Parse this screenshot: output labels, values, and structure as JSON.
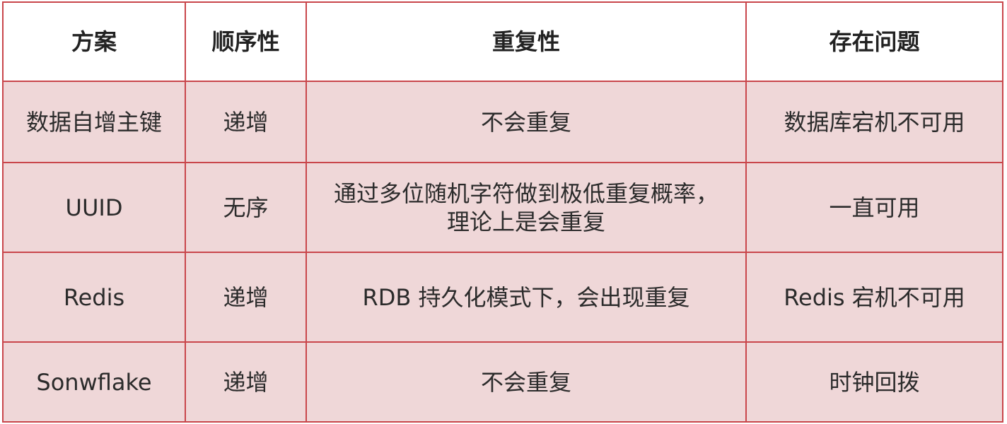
{
  "headers": [
    "方案",
    "顺序性",
    "重复性",
    "存在问题"
  ],
  "rows": [
    {
      "scheme": "数据自增主键",
      "order": "递增",
      "dup_lines": [
        "不会重复"
      ],
      "issue": "数据库宕机不可用"
    },
    {
      "scheme": "UUID",
      "order": "无序",
      "dup_lines": [
        "通过多位随机字符做到极低重复概率，",
        "理论上是会重复"
      ],
      "issue": "一直可用"
    },
    {
      "scheme": "Redis",
      "order": "递增",
      "dup_lines": [
        "RDB 持久化模式下，会出现重复"
      ],
      "issue": "Redis 宕机不可用"
    },
    {
      "scheme": "Sonwflake",
      "order": "递增",
      "dup_lines": [
        "不会重复"
      ],
      "issue": "时钟回拨"
    }
  ],
  "colors": {
    "border": "#c9464b",
    "row_bg": "#efd7d8",
    "header_bg": "#ffffff"
  }
}
